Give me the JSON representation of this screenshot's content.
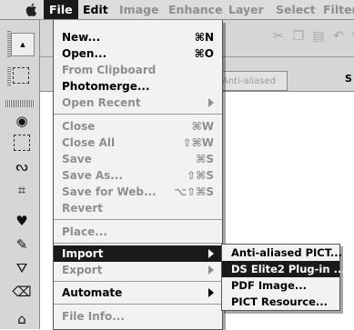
{
  "menubar": {
    "items": [
      {
        "label": "File",
        "active": true
      },
      {
        "label": "Edit"
      },
      {
        "label": "Image"
      },
      {
        "label": "Enhance"
      },
      {
        "label": "Layer"
      },
      {
        "label": "Select"
      },
      {
        "label": "Filter"
      }
    ]
  },
  "file_menu": {
    "items": [
      {
        "label": "New...",
        "shortcut": "⌘N",
        "enabled": true
      },
      {
        "label": "Open...",
        "shortcut": "⌘O",
        "enabled": true
      },
      {
        "label": "From Clipboard",
        "shortcut": "",
        "enabled": false
      },
      {
        "label": "Photomerge...",
        "shortcut": "",
        "enabled": true
      },
      {
        "label": "Open Recent",
        "shortcut": "",
        "enabled": false,
        "submenu": true
      },
      {
        "label": "Close",
        "shortcut": "⌘W",
        "enabled": false
      },
      {
        "label": "Close All",
        "shortcut": "⇧⌘W",
        "enabled": false
      },
      {
        "label": "Save",
        "shortcut": "⌘S",
        "enabled": false
      },
      {
        "label": "Save As...",
        "shortcut": "⇧⌘S",
        "enabled": false
      },
      {
        "label": "Save for Web...",
        "shortcut": "⌥⇧⌘S",
        "enabled": false
      },
      {
        "label": "Revert",
        "shortcut": "",
        "enabled": false
      },
      {
        "label": "Place...",
        "shortcut": "",
        "enabled": false
      },
      {
        "label": "Import",
        "shortcut": "",
        "enabled": true,
        "submenu": true,
        "highlighted": true
      },
      {
        "label": "Export",
        "shortcut": "",
        "enabled": false,
        "submenu": true
      },
      {
        "label": "Automate",
        "shortcut": "",
        "enabled": true,
        "submenu": true
      },
      {
        "label": "File Info...",
        "shortcut": "",
        "enabled": false
      }
    ]
  },
  "import_submenu": {
    "items": [
      {
        "label": "Anti-aliased PICT..."
      },
      {
        "label": "DS Elite2 Plug-in ...",
        "highlighted": true
      },
      {
        "label": "PDF Image..."
      },
      {
        "label": "PICT Resource..."
      }
    ]
  },
  "options_bar": {
    "anti_aliased_label": "Anti-aliased",
    "trailing_text": "S"
  },
  "icons": {
    "apple": "apple-icon",
    "marquee": "rect-marquee-icon",
    "lasso": "lasso-icon",
    "crop": "crop-icon",
    "brush": "brush-icon",
    "eye": "eye-icon"
  },
  "colors": {
    "highlight_bg": "#1a1a1a",
    "disabled_text": "#8e8e8e",
    "menu_bg": "#f2f2f2"
  }
}
